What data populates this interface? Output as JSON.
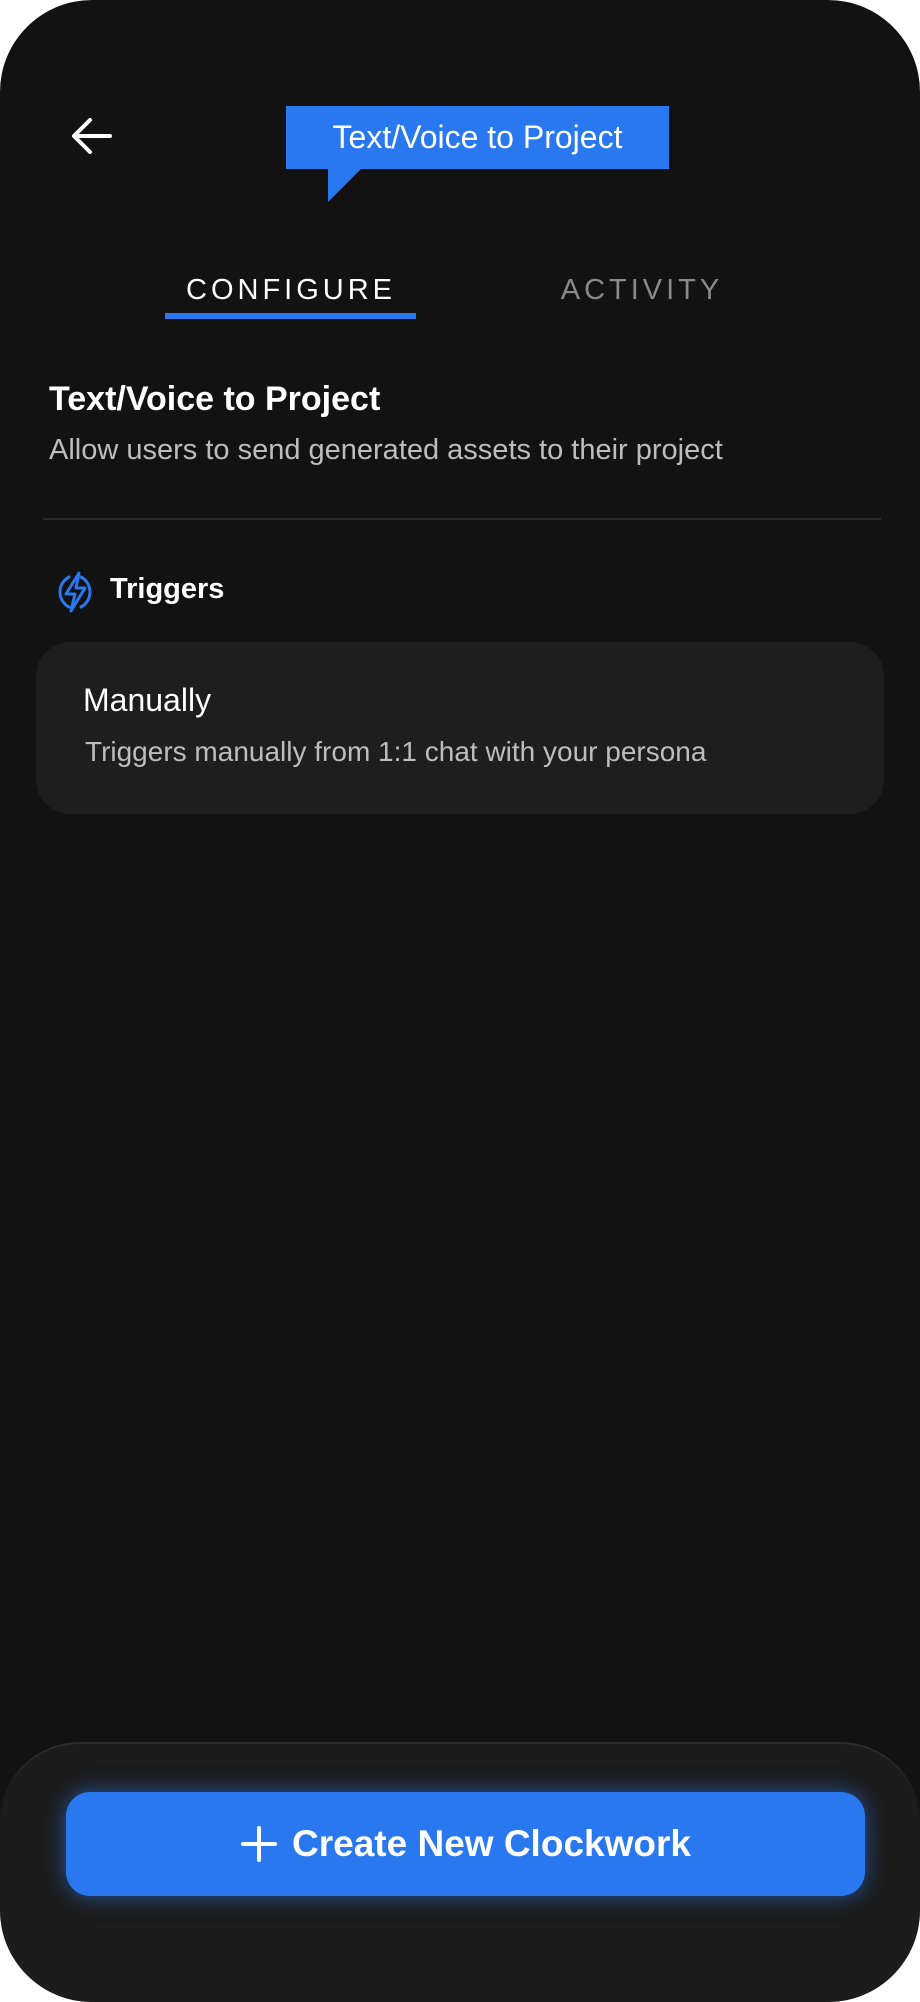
{
  "header": {
    "back_icon": "arrow-left-icon",
    "title_tooltip": "Text/Voice to Project"
  },
  "tabs": [
    {
      "label": "CONFIGURE",
      "active": true
    },
    {
      "label": "ACTIVITY",
      "active": false
    }
  ],
  "main": {
    "title": "Text/Voice to Project",
    "description": "Allow users to send generated assets to their project",
    "triggers_section": {
      "icon": "lightning-icon",
      "label": "Triggers",
      "items": [
        {
          "title": "Manually",
          "description": "Triggers manually from 1:1 chat with your persona"
        }
      ]
    }
  },
  "footer": {
    "create_button_icon": "plus-icon",
    "create_button_label": "Create New Clockwork"
  },
  "colors": {
    "background": "#121212",
    "accent": "#2a78f0",
    "card": "#1e1e1e",
    "muted_text": "#bdbdbd",
    "inactive_tab": "#8a8a8a"
  }
}
